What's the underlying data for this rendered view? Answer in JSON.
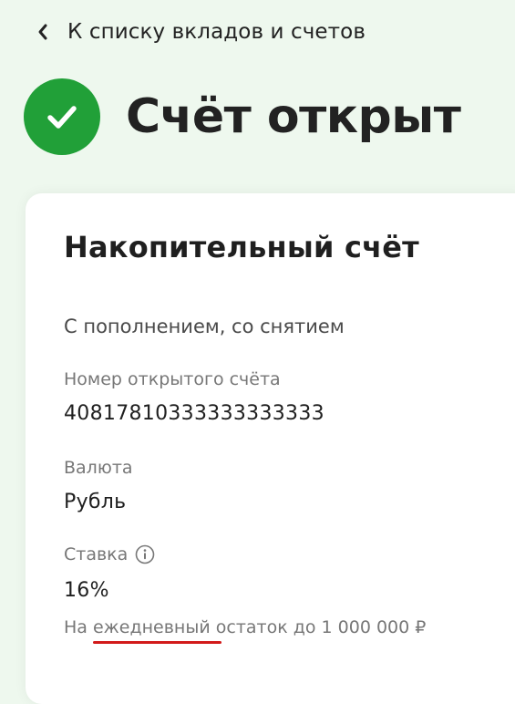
{
  "nav": {
    "back_label": "К списку вкладов и счетов"
  },
  "header": {
    "status_title": "Счёт открыт"
  },
  "account": {
    "title": "Накопительный счёт",
    "features": "С пополнением, со снятием",
    "number_label": "Номер открытого счёта",
    "number_value": "40817810333333333333",
    "currency_label": "Валюта",
    "currency_value": "Рубль",
    "rate_label": "Ставка",
    "rate_value": "16%",
    "rate_note_prefix": "На ",
    "rate_note_highlight": "ежедневный",
    "rate_note_suffix": " остаток до 1 000 000 ₽"
  },
  "icons": {
    "back": "chevron-left-icon",
    "status": "check-circle-icon",
    "info": "info-icon"
  },
  "colors": {
    "background": "#eef8ee",
    "accent_green": "#21a038",
    "annotation_red": "#d21a1a"
  }
}
